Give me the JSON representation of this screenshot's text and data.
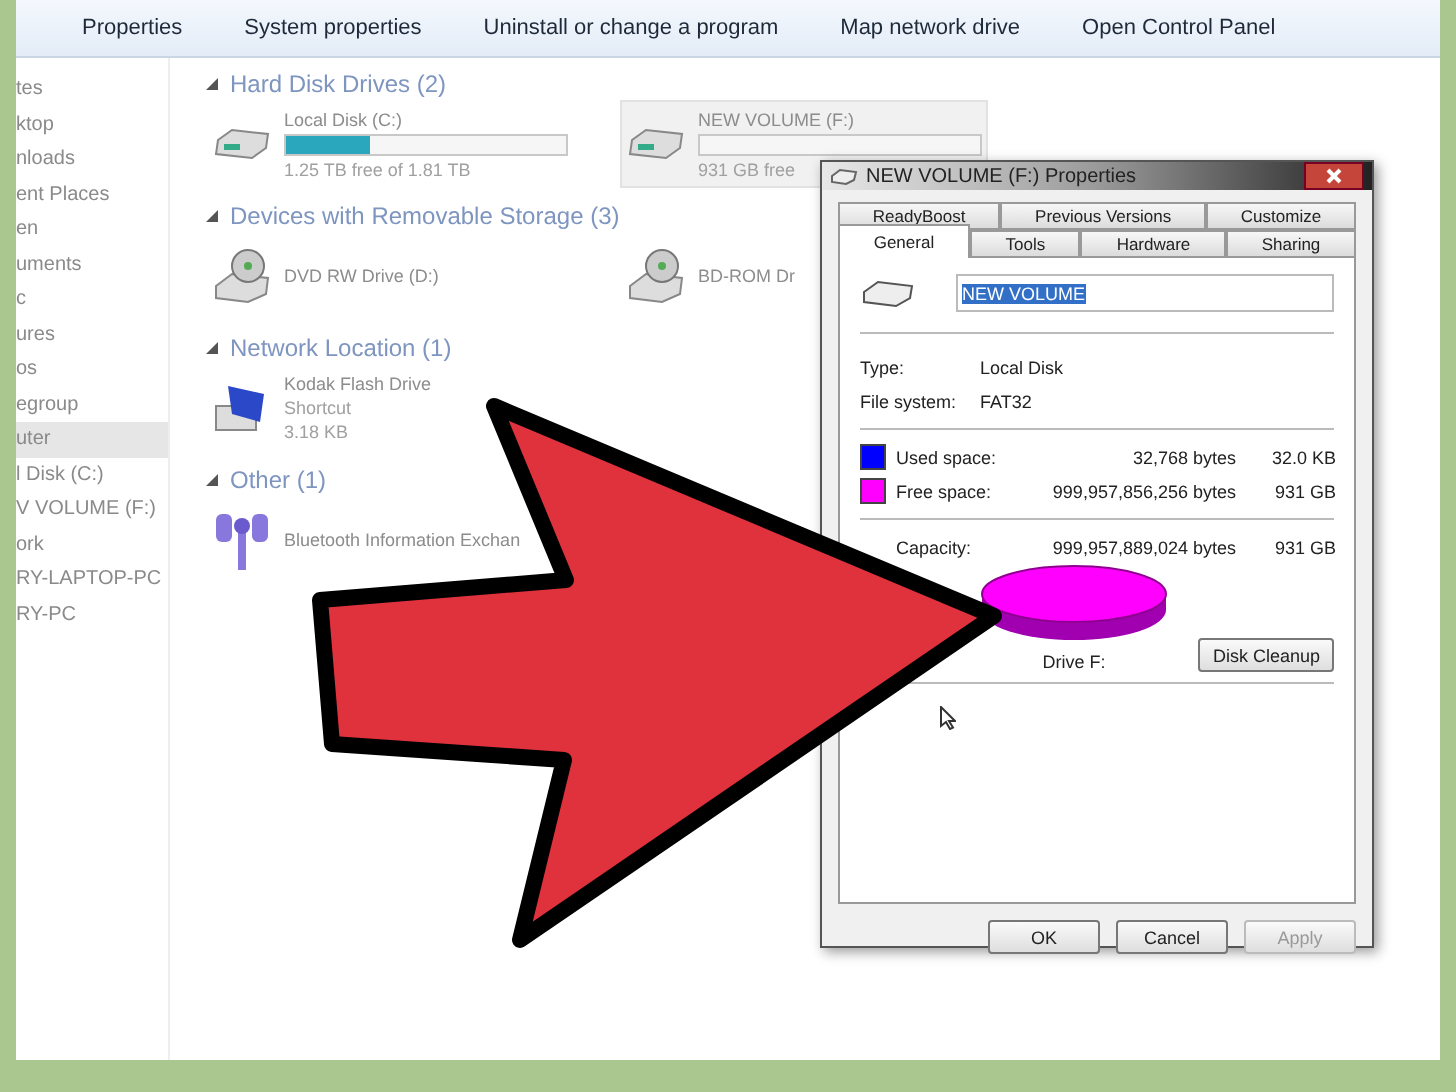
{
  "toolbar": {
    "items": [
      "Properties",
      "System properties",
      "Uninstall or change a program",
      "Map network drive",
      "Open Control Panel"
    ]
  },
  "sidebar": {
    "items": [
      {
        "label": "tes",
        "selected": false
      },
      {
        "label": "ktop",
        "selected": false
      },
      {
        "label": "nloads",
        "selected": false
      },
      {
        "label": "ent Places",
        "selected": false
      },
      {
        "label": "en",
        "selected": false
      },
      {
        "label": "uments",
        "selected": false
      },
      {
        "label": "c",
        "selected": false
      },
      {
        "label": "ures",
        "selected": false
      },
      {
        "label": "os",
        "selected": false
      },
      {
        "label": "egroup",
        "selected": false
      },
      {
        "label": "uter",
        "selected": true
      },
      {
        "label": "l Disk (C:)",
        "selected": false
      },
      {
        "label": "V VOLUME (F:)",
        "selected": false
      },
      {
        "label": "ork",
        "selected": false
      },
      {
        "label": "RY-LAPTOP-PC",
        "selected": false
      },
      {
        "label": "RY-PC",
        "selected": false
      }
    ]
  },
  "sections": [
    {
      "title": "Hard Disk Drives (2)",
      "items": [
        {
          "kind": "disk",
          "name": "Local Disk (C:)",
          "level": 0.3,
          "details": [
            "1.25 TB free of 1.81 TB"
          ],
          "selected": false
        },
        {
          "kind": "disk",
          "name": "NEW VOLUME (F:)",
          "level": 0,
          "details": [
            "931 GB free"
          ],
          "selected": true
        }
      ]
    },
    {
      "title": "Devices with Removable Storage (3)",
      "items": [
        {
          "kind": "optical",
          "name": "DVD RW Drive (D:)",
          "selected": false
        },
        {
          "kind": "optical",
          "name": "BD-ROM Dr",
          "selected": false
        }
      ]
    },
    {
      "title": "Network Location (1)",
      "items": [
        {
          "kind": "network",
          "name": "Kodak Flash Drive",
          "details": [
            "Shortcut",
            "3.18 KB"
          ],
          "selected": false
        }
      ]
    },
    {
      "title": "Other (1)",
      "items": [
        {
          "kind": "other",
          "name": "Bluetooth Information Exchan",
          "selected": false
        }
      ]
    }
  ],
  "dialog": {
    "title": "NEW VOLUME (F:) Properties",
    "tab_rows": [
      [
        {
          "label": "ReadyBoost",
          "selected": false
        },
        {
          "label": "Previous Versions",
          "selected": false
        },
        {
          "label": "Customize",
          "selected": false
        }
      ],
      [
        {
          "label": "General",
          "selected": true
        },
        {
          "label": "Tools",
          "selected": false
        },
        {
          "label": "Hardware",
          "selected": false
        },
        {
          "label": "Sharing",
          "selected": false
        }
      ]
    ],
    "volume_name": "NEW VOLUME",
    "info": [
      {
        "label": "Type:",
        "value": "Local Disk"
      },
      {
        "label": "File system:",
        "value": "FAT32"
      }
    ],
    "space": [
      {
        "label": "Used space:",
        "bytes": "32,768 bytes",
        "size": "32.0 KB",
        "color": "#0000ff"
      },
      {
        "label": "Free space:",
        "bytes": "999,957,856,256 bytes",
        "size": "931 GB",
        "color": "#ff00ff"
      }
    ],
    "capacity": {
      "label": "Capacity:",
      "bytes": "999,957,889,024 bytes",
      "size": "931 GB"
    },
    "drive_label": "Drive F:",
    "cleanup_button": "Disk Cleanup",
    "buttons": [
      {
        "label": "OK",
        "disabled": false
      },
      {
        "label": "Cancel",
        "disabled": false
      },
      {
        "label": "Apply",
        "disabled": true
      }
    ]
  }
}
